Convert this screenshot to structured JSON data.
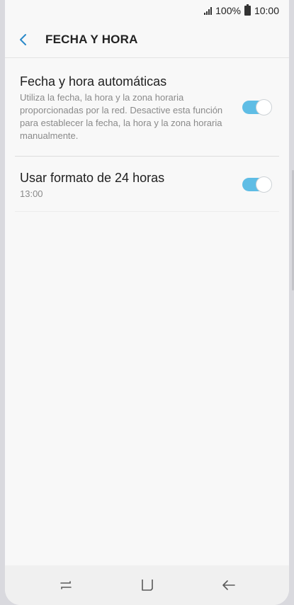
{
  "status": {
    "battery_text": "100%",
    "time": "10:00"
  },
  "header": {
    "title": "FECHA Y HORA"
  },
  "settings": [
    {
      "title": "Fecha y hora automáticas",
      "subtitle": "Utiliza la fecha, la hora y la zona horaria proporcionadas por la red. Desactive esta función para establecer la fecha, la hora y la zona horaria manualmente.",
      "enabled": true
    },
    {
      "title": "Usar formato de 24 horas",
      "subtitle": "13:00",
      "enabled": true
    }
  ],
  "colors": {
    "toggle_on": "#5fbde5",
    "accent": "#2a89c9"
  },
  "icons": {
    "back": "arrow-left-icon",
    "recent": "recent-apps-icon",
    "home": "home-icon",
    "nav_back": "back-arrow-icon"
  }
}
